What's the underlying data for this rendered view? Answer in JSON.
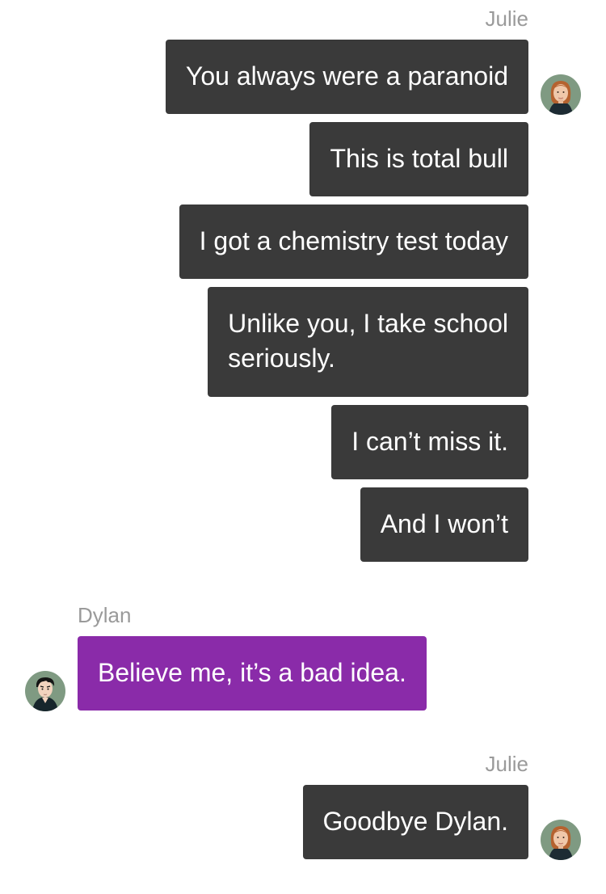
{
  "conversation": {
    "group1": {
      "sender": "Julie",
      "messages": [
        "You always were a paranoid",
        "This is total bull",
        "I got a chemistry test today",
        "Unlike you, I take school\nseriously.",
        "I can’t miss it.",
        "And I won’t"
      ]
    },
    "group2": {
      "sender": "Dylan",
      "messages": [
        "Believe me, it’s a bad idea."
      ]
    },
    "group3": {
      "sender": "Julie",
      "messages": [
        "Goodbye Dylan."
      ]
    }
  },
  "avatars": {
    "julie": "woman-avatar-icon",
    "dylan": "man-avatar-icon"
  },
  "colors": {
    "julie_bubble": "#3a3a3a",
    "dylan_bubble": "#8a2ba9",
    "name_text": "#9a9a9a",
    "bubble_text": "#ffffff"
  }
}
